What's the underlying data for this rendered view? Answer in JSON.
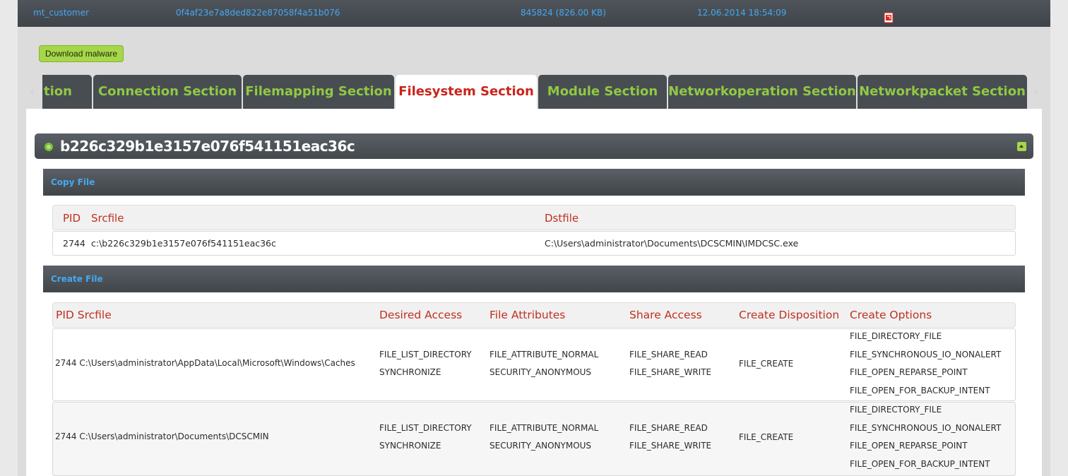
{
  "topbar": {
    "name": "mt_customer",
    "hash": "0f4af23e7a8ded822e87058f4a51b076",
    "size": "845824 (826.00 KB)",
    "date": "12.06.2014 18:54:09",
    "icons": [
      "excel-export-icon",
      "pdf-export-icon"
    ]
  },
  "download_label": "Download malware",
  "tabs": {
    "prev": "‹",
    "next": "›",
    "items": [
      {
        "label": "tion"
      },
      {
        "label": "Connection Section"
      },
      {
        "label": "Filemapping Section"
      },
      {
        "label": "Filesystem Section"
      },
      {
        "label": "Module Section"
      },
      {
        "label": "Networkoperation Section"
      },
      {
        "label": "Networkpacket Section"
      }
    ],
    "active_index": 3
  },
  "panel": {
    "hash": "b226c329b1e3157e076f541151eac36c"
  },
  "copy_file": {
    "title": "Copy File",
    "headers": {
      "pid": "PID",
      "src": "Srcfile",
      "dst": "Dstfile"
    },
    "rows": [
      {
        "pid": "2744",
        "src": "c:\\b226c329b1e3157e076f541151eac36c",
        "dst": "C:\\Users\\administrator\\Documents\\DCSCMIN\\IMDCSC.exe"
      }
    ]
  },
  "create_file": {
    "title": "Create File",
    "headers": {
      "pid_src": "PID Srcfile",
      "desired": "Desired Access",
      "attrs": "File Attributes",
      "share": "Share Access",
      "disp": "Create Disposition",
      "opts": "Create Options"
    },
    "rows": [
      {
        "pid_src": "2744 C:\\Users\\administrator\\AppData\\Local\\Microsoft\\Windows\\Caches",
        "desired": [
          "FILE_LIST_DIRECTORY",
          "SYNCHRONIZE"
        ],
        "attrs": [
          "FILE_ATTRIBUTE_NORMAL",
          "SECURITY_ANONYMOUS"
        ],
        "share": [
          "FILE_SHARE_READ",
          "FILE_SHARE_WRITE"
        ],
        "disp": "FILE_CREATE",
        "opts": [
          "FILE_DIRECTORY_FILE",
          "FILE_SYNCHRONOUS_IO_NONALERT",
          "FILE_OPEN_REPARSE_POINT",
          "FILE_OPEN_FOR_BACKUP_INTENT"
        ]
      },
      {
        "pid_src": "2744 C:\\Users\\administrator\\Documents\\DCSCMIN",
        "desired": [
          "FILE_LIST_DIRECTORY",
          "SYNCHRONIZE"
        ],
        "attrs": [
          "FILE_ATTRIBUTE_NORMAL",
          "SECURITY_ANONYMOUS"
        ],
        "share": [
          "FILE_SHARE_READ",
          "FILE_SHARE_WRITE"
        ],
        "disp": "FILE_CREATE",
        "opts": [
          "FILE_DIRECTORY_FILE",
          "FILE_SYNCHRONOUS_IO_NONALERT",
          "FILE_OPEN_REPARSE_POINT",
          "FILE_OPEN_FOR_BACKUP_INTENT"
        ]
      }
    ]
  }
}
